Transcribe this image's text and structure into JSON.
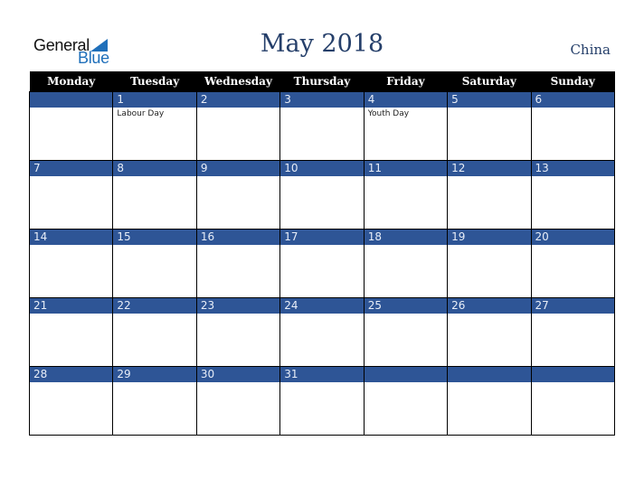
{
  "logo": {
    "word1": "General",
    "word2": "Blue",
    "icon": "triangle-flag-icon"
  },
  "header": {
    "title": "May 2018",
    "country": "China"
  },
  "colors": {
    "title": "#253f6a",
    "day_bar": "#2e5596",
    "header_bg": "#000000",
    "logo_blue": "#1f6fba"
  },
  "calendar": {
    "weekdays": [
      "Monday",
      "Tuesday",
      "Wednesday",
      "Thursday",
      "Friday",
      "Saturday",
      "Sunday"
    ],
    "weeks": [
      [
        {
          "day": "",
          "holiday": ""
        },
        {
          "day": "1",
          "holiday": "Labour Day"
        },
        {
          "day": "2",
          "holiday": ""
        },
        {
          "day": "3",
          "holiday": ""
        },
        {
          "day": "4",
          "holiday": "Youth Day"
        },
        {
          "day": "5",
          "holiday": ""
        },
        {
          "day": "6",
          "holiday": ""
        }
      ],
      [
        {
          "day": "7",
          "holiday": ""
        },
        {
          "day": "8",
          "holiday": ""
        },
        {
          "day": "9",
          "holiday": ""
        },
        {
          "day": "10",
          "holiday": ""
        },
        {
          "day": "11",
          "holiday": ""
        },
        {
          "day": "12",
          "holiday": ""
        },
        {
          "day": "13",
          "holiday": ""
        }
      ],
      [
        {
          "day": "14",
          "holiday": ""
        },
        {
          "day": "15",
          "holiday": ""
        },
        {
          "day": "16",
          "holiday": ""
        },
        {
          "day": "17",
          "holiday": ""
        },
        {
          "day": "18",
          "holiday": ""
        },
        {
          "day": "19",
          "holiday": ""
        },
        {
          "day": "20",
          "holiday": ""
        }
      ],
      [
        {
          "day": "21",
          "holiday": ""
        },
        {
          "day": "22",
          "holiday": ""
        },
        {
          "day": "23",
          "holiday": ""
        },
        {
          "day": "24",
          "holiday": ""
        },
        {
          "day": "25",
          "holiday": ""
        },
        {
          "day": "26",
          "holiday": ""
        },
        {
          "day": "27",
          "holiday": ""
        }
      ],
      [
        {
          "day": "28",
          "holiday": ""
        },
        {
          "day": "29",
          "holiday": ""
        },
        {
          "day": "30",
          "holiday": ""
        },
        {
          "day": "31",
          "holiday": ""
        },
        {
          "day": "",
          "holiday": ""
        },
        {
          "day": "",
          "holiday": ""
        },
        {
          "day": "",
          "holiday": ""
        }
      ]
    ]
  }
}
